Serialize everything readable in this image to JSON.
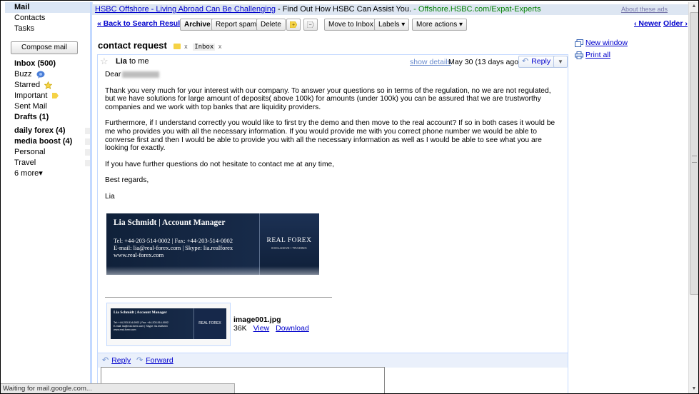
{
  "nav": {
    "mail": "Mail",
    "contacts": "Contacts",
    "tasks": "Tasks",
    "compose": "Compose mail",
    "labels": [
      {
        "label": "Inbox (500)",
        "bold": true
      },
      {
        "label": "Buzz",
        "bold": false,
        "icon": "buzz-icon"
      },
      {
        "label": "Starred",
        "bold": false,
        "icon": "star-icon"
      },
      {
        "label": "Important",
        "bold": false,
        "icon": "important-icon"
      },
      {
        "label": "Sent Mail",
        "bold": false
      },
      {
        "label": "Drafts (1)",
        "bold": true
      },
      {
        "label": "daily forex (4)",
        "bold": true
      },
      {
        "label": "media boost (4)",
        "bold": true
      },
      {
        "label": "Personal",
        "bold": false
      },
      {
        "label": "Travel",
        "bold": false
      }
    ],
    "more": "6 more▾"
  },
  "ad": {
    "title": "HSBC Offshore - Living Abroad Can Be Challenging",
    "separator": " - ",
    "text": "Find Out How HSBC Can Assist You.",
    "source": " - Offshore.HSBC.com/Expat-Experts",
    "about": "About these ads"
  },
  "toolbar": {
    "back": "« Back to Search Results",
    "archive": "Archive",
    "spam": "Report spam",
    "delete": "Delete",
    "move_inbox": "Move to Inbox",
    "labels": "Labels ▾",
    "more_actions": "More actions ▾",
    "newer": "‹ Newer",
    "older": "Older ›"
  },
  "thread": {
    "subject": "contact request",
    "tag_inbox": "Inbox",
    "tag_close": "x"
  },
  "message": {
    "sender": "Lia",
    "to": "to me",
    "show_details": "show details",
    "date": "May 30 (13 days ago)",
    "reply": "Reply",
    "greeting": "Dear",
    "p1": "Thank you very much for your interest with our company. To answer your questions so in terms of the regulation, no we are not regulated, but we have solutions for large amount of deposits( above 100k) for amounts (under 100k) you can be assured that we are trustworthy companies and we work with top banks that are liquidity providers.",
    "p2": "Furthermore, if I understand correctly you would like to first try the demo and then move to the real account? If so in both cases it would be me who provides you with all the necessary information. If you would provide me with you correct phone number we would be able to converse first and then I would be able to provide you with all the necessary information as well as I would be able to see what you are looking for exactly.",
    "p3": "If you have further questions do not hesitate to contact me at any time,",
    "p4": "Best regards,",
    "p5": "Lia"
  },
  "signature": {
    "name": "Lia Schmidt  |  Account Manager",
    "phone": "Tel: +44-203-514-0002  |  Fax: +44-203-514-0002",
    "email": "E-mail: lia@real-forex.com  |  Skype: lia.realforex",
    "web": "www.real-forex.com",
    "brand": "REAL FOREX",
    "brand_sub": "EXCLUSIVE • TRADING"
  },
  "attachment": {
    "filename": "image001.jpg",
    "size": "36K",
    "view": "View",
    "download": "Download"
  },
  "actions": {
    "reply": "Reply",
    "forward": "Forward"
  },
  "side": {
    "new_window": "New window",
    "print_all": "Print all"
  },
  "status": "Waiting for mail.google.com..."
}
